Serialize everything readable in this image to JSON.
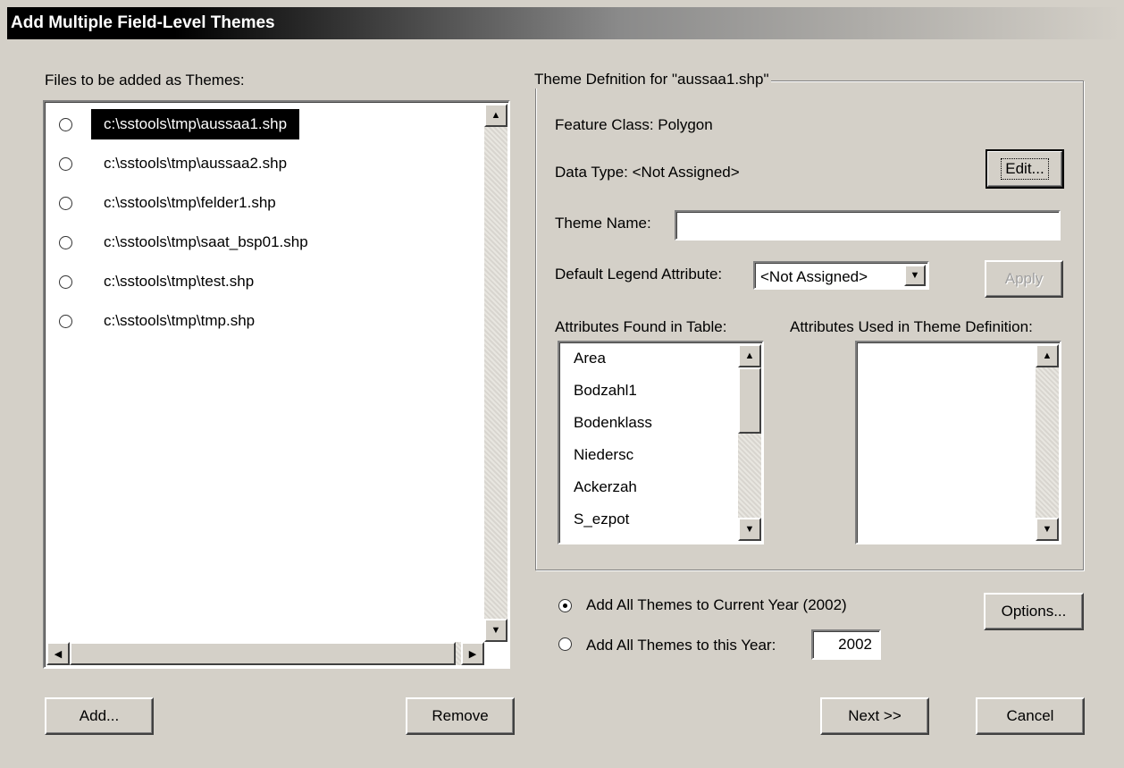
{
  "window": {
    "title": "Add Multiple Field-Level Themes"
  },
  "files": {
    "label": "Files to be added as Themes:",
    "items": [
      {
        "label": "c:\\sstools\\tmp\\aussaa1.shp",
        "selected": true
      },
      {
        "label": "c:\\sstools\\tmp\\aussaa2.shp",
        "selected": false
      },
      {
        "label": "c:\\sstools\\tmp\\felder1.shp",
        "selected": false
      },
      {
        "label": "c:\\sstools\\tmp\\saat_bsp01.shp",
        "selected": false
      },
      {
        "label": "c:\\sstools\\tmp\\test.shp",
        "selected": false
      },
      {
        "label": "c:\\sstools\\tmp\\tmp.shp",
        "selected": false
      }
    ],
    "add_label": "Add...",
    "remove_label": "Remove"
  },
  "theme": {
    "group_title": "Theme Defnition for \"aussaa1.shp\"",
    "feature_class": "Feature Class: Polygon",
    "data_type": "Data Type: <Not Assigned>",
    "edit_label": "Edit...",
    "theme_name_label": "Theme Name:",
    "theme_name_value": "",
    "legend_label": "Default Legend Attribute:",
    "legend_value": "<Not Assigned>",
    "apply_label": "Apply",
    "found_label": "Attributes Found in Table:",
    "found_items": [
      "Area",
      "Bodzahl1",
      "Bodenklass",
      "Niedersc",
      "Ackerzah",
      "S_ezpot"
    ],
    "used_label": "Attributes Used in Theme Definition:",
    "used_items": []
  },
  "year": {
    "current_label": "Add All Themes to Current Year (2002)",
    "this_year_label": "Add All Themes to this Year:",
    "year_value": "2002",
    "selected": "current",
    "options_label": "Options..."
  },
  "footer": {
    "next_label": "Next >>",
    "cancel_label": "Cancel"
  }
}
